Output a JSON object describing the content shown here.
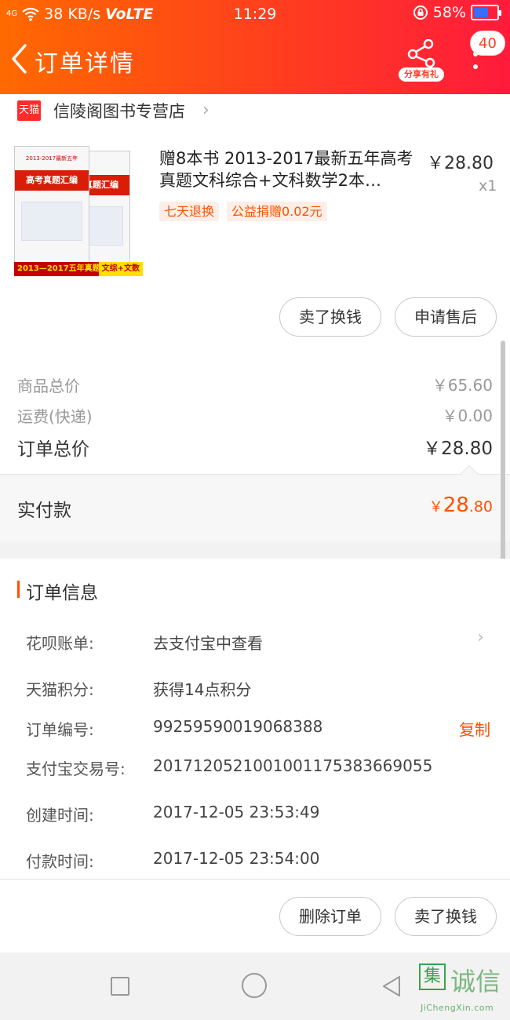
{
  "status_bar": {
    "network": "4G",
    "speed": "38 KB/s",
    "volte": "VoLTE",
    "time": "11:29",
    "battery": "58%"
  },
  "header": {
    "title": "订单详情",
    "share_label": "分享有礼",
    "badge_count": "40"
  },
  "shop": {
    "tmall_logo": "天猫",
    "name": "信陵阁图书专营店"
  },
  "product": {
    "title": "赠8本书 2013-2017最新五年高考真题文科综合+文科数学2本…",
    "price": "￥28.80",
    "qty": "x1",
    "tags": [
      "七天退换",
      "公益捐赠0.02元"
    ],
    "image_text": {
      "book_title": "高考真题汇编",
      "book_subtitle": "2013-2017最新五年",
      "strip": "2013—2017五年真题",
      "corner": "文综+文数"
    }
  },
  "item_buttons": {
    "sell": "卖了换钱",
    "aftersale": "申请售后"
  },
  "price_summary": {
    "goods_total_label": "商品总价",
    "goods_total": "￥65.60",
    "shipping_label": "运费(快递)",
    "shipping": "￥0.00",
    "order_total_label": "订单总价",
    "order_total": "￥28.80",
    "paid_label": "实付款",
    "paid_currency": "￥",
    "paid_int": "28",
    "paid_dec": ".80"
  },
  "order_info": {
    "title": "订单信息",
    "rows": [
      {
        "key": "花呗账单:",
        "value": "去支付宝中查看"
      },
      {
        "key": "天猫积分:",
        "value": "获得14点积分"
      },
      {
        "key": "订单编号:",
        "value": "99259590019068388",
        "action": "复制"
      },
      {
        "key": "支付宝交易号:",
        "value": "2017120521001001175383669055"
      },
      {
        "key": "创建时间:",
        "value": "2017-12-05 23:53:49"
      },
      {
        "key": "付款时间:",
        "value": "2017-12-05 23:54:00"
      }
    ]
  },
  "bottom_actions": {
    "delete": "删除订单",
    "sell": "卖了换钱"
  },
  "watermark": {
    "box_char": "集",
    "text": "诚信",
    "url": "JiChengXin.com"
  },
  "colors": {
    "header_start": "#ff6a00",
    "header_end": "#ff1b3c",
    "accent": "#ff5000"
  }
}
